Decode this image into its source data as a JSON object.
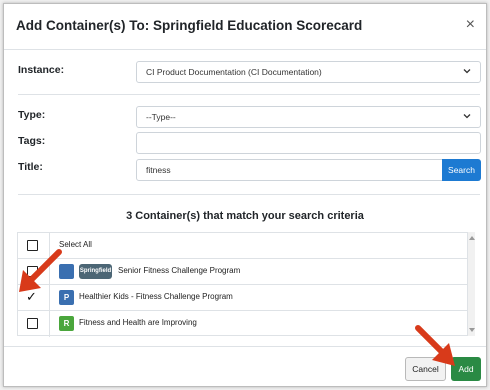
{
  "dialog": {
    "title": "Add Container(s) To: Springfield Education Scorecard",
    "close_glyph": "×"
  },
  "form": {
    "instance_label": "Instance:",
    "instance_value": "CI Product Documentation (CI Documentation)",
    "type_label": "Type:",
    "type_value": "--Type--",
    "tags_label": "Tags:",
    "tags_value": "",
    "title_label": "Title:",
    "title_value": "fitness",
    "search_button": "Search"
  },
  "results": {
    "heading": "3 Container(s) that match your search criteria",
    "select_all": "Select All",
    "items": [
      {
        "logo": "Springfield",
        "label": "Senior Fitness Challenge Program",
        "checked": false,
        "badge_color": "#3a6fb0"
      },
      {
        "badge": "P",
        "label": "Healthier Kids - Fitness Challenge Program",
        "checked": true,
        "badge_color": "#3a6fb0"
      },
      {
        "badge": "R",
        "label": "Fitness and Health are Improving",
        "checked": false,
        "badge_color": "#4aa63c"
      }
    ]
  },
  "footer": {
    "cancel_button": "Cancel",
    "add_button": "Add"
  },
  "colors": {
    "primary_blue": "#1d7ad2",
    "add_green": "#2a8a44",
    "annotation_red": "#d83a1a"
  },
  "icons": {
    "close": "close-icon",
    "dropdown": "chevron-down-icon",
    "checkmark": "checkmark-icon",
    "annotation": "red-arrow-icon"
  }
}
